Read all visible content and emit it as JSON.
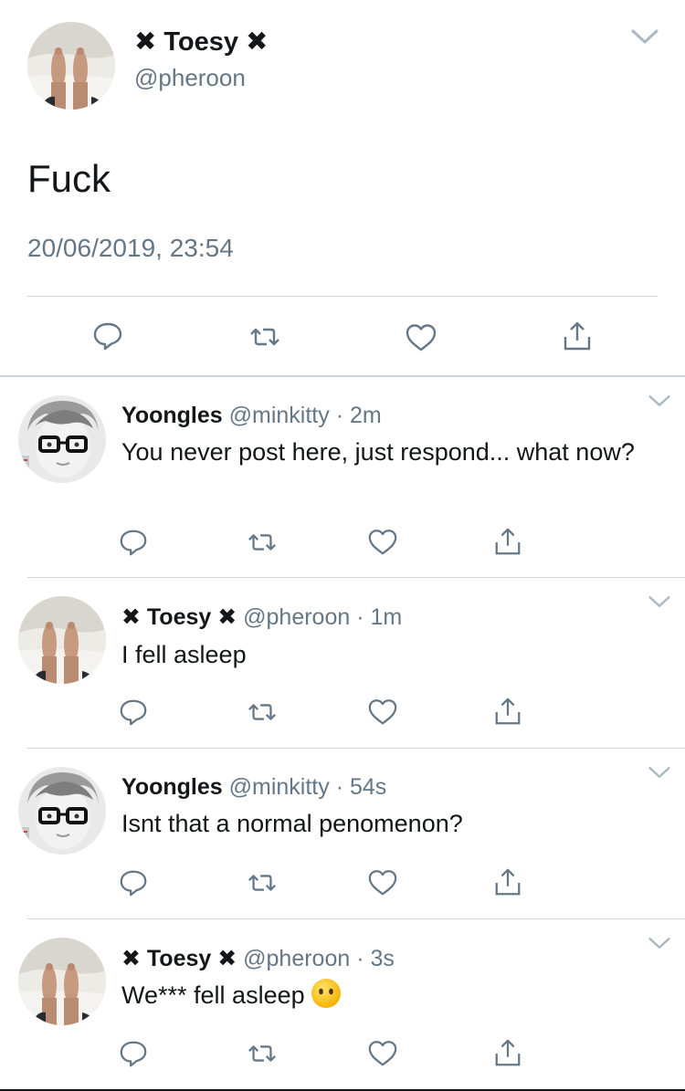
{
  "main_tweet": {
    "author_name": "✖ Toesy ✖",
    "author_handle": "@pheroon",
    "text": "Fuck",
    "timestamp": "20/06/2019, 23:54",
    "actions": [
      "reply-icon",
      "retweet-icon",
      "like-icon",
      "share-icon"
    ]
  },
  "replies": [
    {
      "author_name": "Yoongles",
      "author_handle": "@minkitty",
      "time": "2m",
      "text": "You never post here, just respond... what now?",
      "avatar": "glasses-person-avatar"
    },
    {
      "author_name": "✖ Toesy ✖",
      "author_handle": "@pheroon",
      "time": "1m",
      "text": "I fell asleep",
      "avatar": "feet-avatar"
    },
    {
      "author_name": "Yoongles",
      "author_handle": "@minkitty",
      "time": "54s",
      "text": "Isnt that a normal penomenon?",
      "avatar": "glasses-person-avatar"
    },
    {
      "author_name": "✖ Toesy ✖",
      "author_handle": "@pheroon",
      "time": "3s",
      "text": "We*** fell asleep",
      "emoji": "no-mouth-face-emoji",
      "avatar": "feet-avatar"
    }
  ],
  "colors": {
    "text": "#14171a",
    "secondary": "#657786",
    "divider": "#ccd6dd"
  }
}
